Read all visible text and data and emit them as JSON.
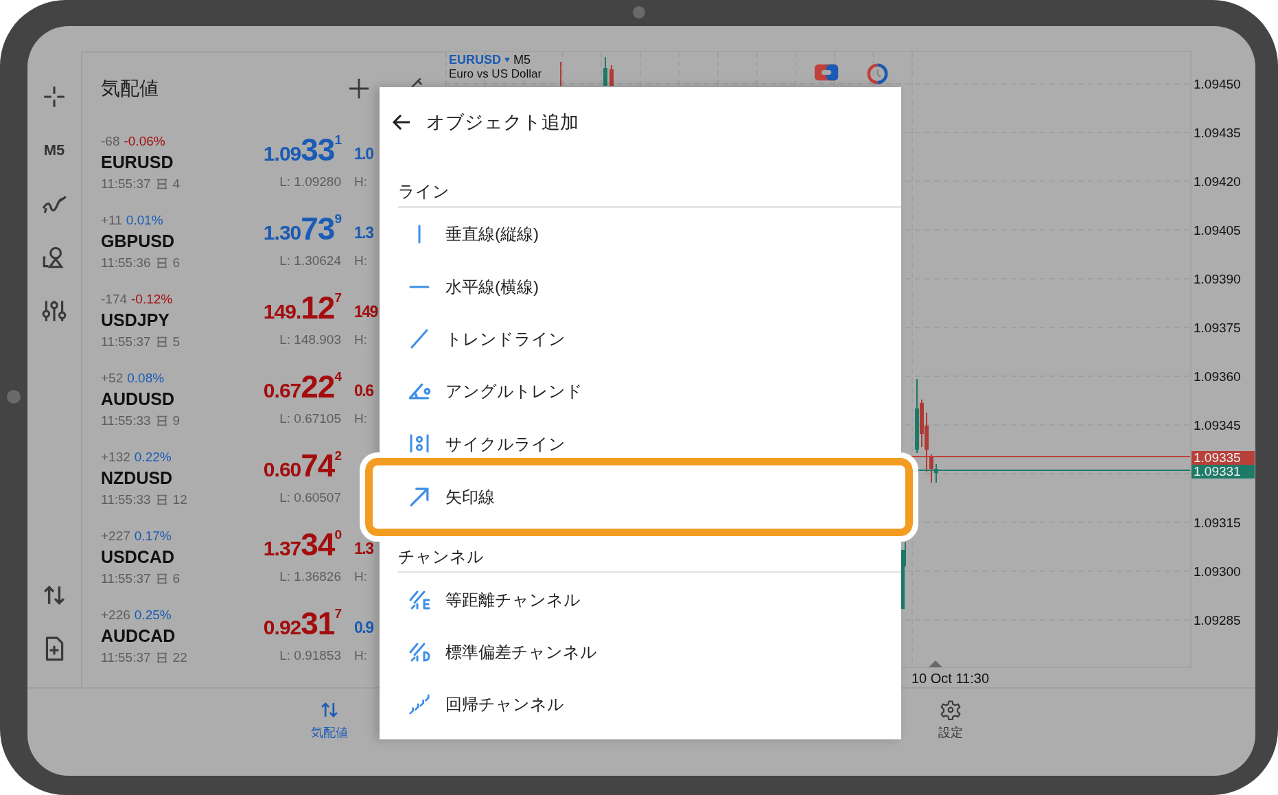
{
  "rail": {
    "timeframe": "M5"
  },
  "quotes": {
    "title": "気配値",
    "rows": [
      {
        "change": "-68",
        "percent": {
          "text": "-0.06%",
          "color": "#a30d0d"
        },
        "symbol": "EURUSD",
        "time": "11:55:37",
        "spread": "4",
        "bid": {
          "head": "1.09",
          "big": "33",
          "pip": "1",
          "color": "#1a5bb5"
        },
        "low": "L: 1.09280",
        "ask": {
          "text": "1.0",
          "color": "#1a5bb5"
        },
        "high": "H:"
      },
      {
        "change": "+11",
        "percent": {
          "text": "0.01%",
          "color": "#1a5bb5"
        },
        "symbol": "GBPUSD",
        "time": "11:55:36",
        "spread": "6",
        "bid": {
          "head": "1.30",
          "big": "73",
          "pip": "9",
          "color": "#1a5bb5"
        },
        "low": "L: 1.30624",
        "ask": {
          "text": "1.3",
          "color": "#1a5bb5"
        },
        "high": "H:"
      },
      {
        "change": "-174",
        "percent": {
          "text": "-0.12%",
          "color": "#a30d0d"
        },
        "symbol": "USDJPY",
        "time": "11:55:37",
        "spread": "5",
        "bid": {
          "head": "149.",
          "big": "12",
          "pip": "7",
          "color": "#a30d0d"
        },
        "low": "L: 148.903",
        "ask": {
          "text": "149",
          "color": "#a30d0d"
        },
        "high": "H:"
      },
      {
        "change": "+52",
        "percent": {
          "text": "0.08%",
          "color": "#1a5bb5"
        },
        "symbol": "AUDUSD",
        "time": "11:55:33",
        "spread": "9",
        "bid": {
          "head": "0.67",
          "big": "22",
          "pip": "4",
          "color": "#a30d0d"
        },
        "low": "L: 0.67105",
        "ask": {
          "text": "0.6",
          "color": "#a30d0d"
        },
        "high": "H:"
      },
      {
        "change": "+132",
        "percent": {
          "text": "0.22%",
          "color": "#1a5bb5"
        },
        "symbol": "NZDUSD",
        "time": "11:55:33",
        "spread": "12",
        "bid": {
          "head": "0.60",
          "big": "74",
          "pip": "2",
          "color": "#a30d0d"
        },
        "low": "L: 0.60507"
      },
      {
        "change": "+227",
        "percent": {
          "text": "0.17%",
          "color": "#1a5bb5"
        },
        "symbol": "USDCAD",
        "time": "11:55:37",
        "spread": "6",
        "bid": {
          "head": "1.37",
          "big": "34",
          "pip": "0",
          "color": "#a30d0d"
        },
        "low": "L: 1.36826",
        "ask": {
          "text": "1.3",
          "color": "#a30d0d"
        },
        "high": "H:"
      },
      {
        "change": "+226",
        "percent": {
          "text": "0.25%",
          "color": "#1a5bb5"
        },
        "symbol": "AUDCAD",
        "time": "11:55:37",
        "spread": "22",
        "bid": {
          "head": "0.92",
          "big": "31",
          "pip": "7",
          "color": "#a30d0d"
        },
        "low": "L: 0.91853",
        "ask": {
          "text": "0.9",
          "color": "#1a5bb5"
        },
        "high": "H:"
      }
    ]
  },
  "chart": {
    "symbol": "EURUSD",
    "timeframe": "M5",
    "description": "Euro vs US Dollar",
    "price_axis_upper": [
      "1.09450",
      "1.09435",
      "1.09420",
      "1.09405",
      "1.09390",
      "1.09375",
      "1.09360",
      "1.09345"
    ],
    "tags": [
      {
        "text": "1.09335",
        "color": "#b8403a"
      },
      {
        "text": "1.09331",
        "color": "#1e7a68"
      }
    ],
    "price_axis_lower": [
      "1.09315",
      "1.09300",
      "1.09285"
    ],
    "time_label": "10 Oct 11:30"
  },
  "nav": [
    {
      "label": "気配値",
      "kind": "quotes",
      "selected": true
    },
    {
      "label": "設定",
      "kind": "settings",
      "selected": false
    }
  ],
  "dialog": {
    "title": "オブジェクト追加",
    "sections": [
      {
        "title": "ライン",
        "items": [
          {
            "label": "垂直線(縦線)",
            "kind": "vertical",
            "highlighted": false
          },
          {
            "label": "水平線(横線)",
            "kind": "horizontal",
            "highlighted": false
          },
          {
            "label": "トレンドライン",
            "kind": "trend",
            "highlighted": false
          },
          {
            "label": "アングルトレンド",
            "kind": "angle",
            "highlighted": false
          },
          {
            "label": "サイクルライン",
            "kind": "cycle",
            "highlighted": false
          },
          {
            "label": "矢印線",
            "kind": "arrow",
            "highlighted": true
          }
        ]
      },
      {
        "title": "チャンネル",
        "items": [
          {
            "label": "等距離チャンネル",
            "kind": "equidistant",
            "highlighted": false
          },
          {
            "label": "標準偏差チャンネル",
            "kind": "stddev",
            "highlighted": false
          },
          {
            "label": "回帰チャンネル",
            "kind": "regression",
            "highlighted": false
          }
        ]
      }
    ]
  }
}
